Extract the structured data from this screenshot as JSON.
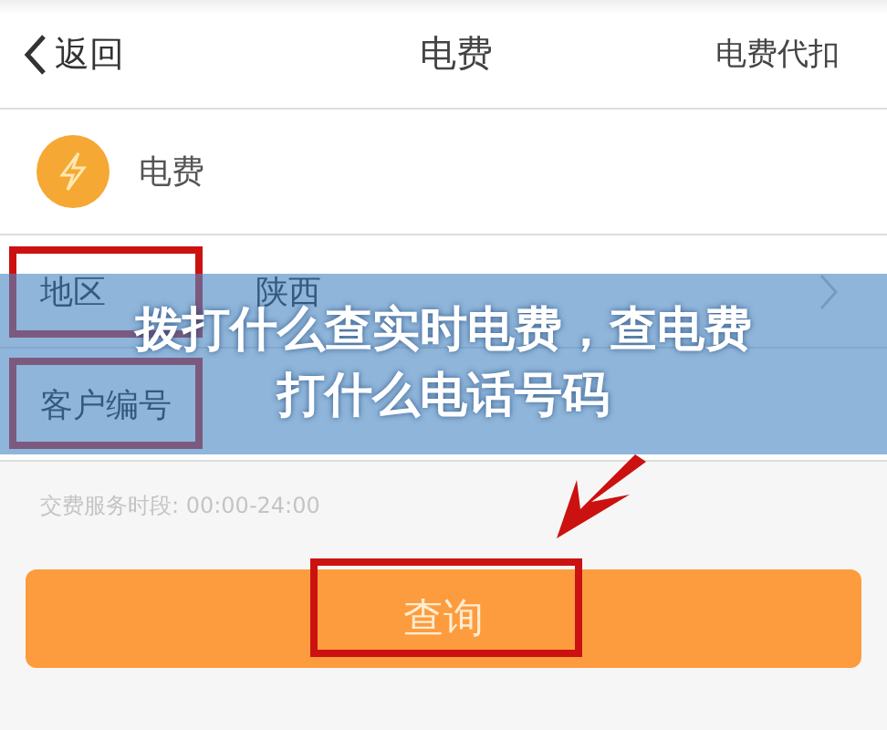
{
  "nav": {
    "back": "返回",
    "title": "电费",
    "action": "电费代扣"
  },
  "service": {
    "name": "电费"
  },
  "form_rows": [
    {
      "label": "地区",
      "value": "陕西",
      "chevron": true,
      "highlighted": true
    },
    {
      "label": "客户编号",
      "chevron": false,
      "highlighted": true
    }
  ],
  "hint": "交费服务时段: 00:00-24:00",
  "query_button": {
    "label": "查询",
    "highlighted": true
  },
  "banner": {
    "lines": [
      "拨打什么查实时电费，查电费",
      "打什么电话号码"
    ]
  }
}
